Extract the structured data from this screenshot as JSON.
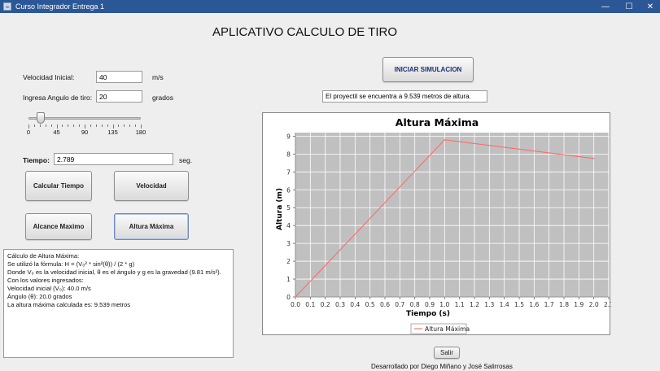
{
  "window": {
    "title": "Curso Integrador Entrega 1",
    "minimize_glyph": "—",
    "maximize_glyph": "☐",
    "close_glyph": "✕",
    "icon": "java-app-icon"
  },
  "heading": "APLICATIVO CALCULO DE TIRO",
  "inputs": {
    "velocity_label": "Velocidad Inicial:",
    "velocity_value": "40",
    "velocity_unit": "m/s",
    "angle_label": "Ingresa Angulo de tiro:",
    "angle_value": "20",
    "angle_unit": "grados",
    "time_label": "Tiempo:",
    "time_value": "2.789",
    "time_unit": "seg."
  },
  "slider": {
    "value": 20,
    "min": 0,
    "max": 180,
    "labels": [
      "0",
      "45",
      "90",
      "135",
      "180"
    ]
  },
  "buttons": {
    "calcular_tiempo": "Calcular Tiempo",
    "velocidad": "Velocidad",
    "alcance_maximo": "Alcance Maximo",
    "altura_maxima": "Altura Máxima",
    "iniciar_simulacion": "INICIAR SIMULACION",
    "salir": "Salir"
  },
  "result_message": "El proyectil se encuentra a 9.539 metros de altura.",
  "output_lines": [
    "Cálculo de Altura Máxima:",
    "Se utilizó la fórmula: H = (V₀² * sin²(θ)) / (2 * g)",
    "Donde V₀ es la velocidad inicial, θ es el ángulo y g es la gravedad (9.81 m/s²).",
    "Con los valores ingresados:",
    "Velocidad inicial (V₀): 40.0 m/s",
    "Ángulo (θ): 20.0 grados",
    "La altura máxima calculada es: 9.539 metros"
  ],
  "credits": "Desarrollado por Diego Miñano y José Salirrosas",
  "chart_data": {
    "type": "line",
    "title": "Altura Máxima",
    "xlabel": "Tiempo (s)",
    "ylabel": "Altura (m)",
    "xlim": [
      0,
      2.1
    ],
    "ylim": [
      0,
      9.2
    ],
    "x_ticks": [
      "0.0",
      "0.1",
      "0.2",
      "0.3",
      "0.4",
      "0.5",
      "0.6",
      "0.7",
      "0.8",
      "0.9",
      "1.0",
      "1.1",
      "1.2",
      "1.3",
      "1.4",
      "1.5",
      "1.6",
      "1.7",
      "1.8",
      "1.9",
      "2.0",
      "2.1"
    ],
    "y_ticks": [
      "0",
      "1",
      "2",
      "3",
      "4",
      "5",
      "6",
      "7",
      "8",
      "9"
    ],
    "grid": true,
    "legend_position": "bottom",
    "colors": {
      "series": "#ff6b6b",
      "plot_bg": "#c0c0c0",
      "grid": "#ffffff"
    },
    "series": [
      {
        "name": "Altura Máxima",
        "x": [
          0.0,
          1.0,
          2.0
        ],
        "y": [
          0.0,
          8.8,
          7.75
        ]
      }
    ]
  }
}
